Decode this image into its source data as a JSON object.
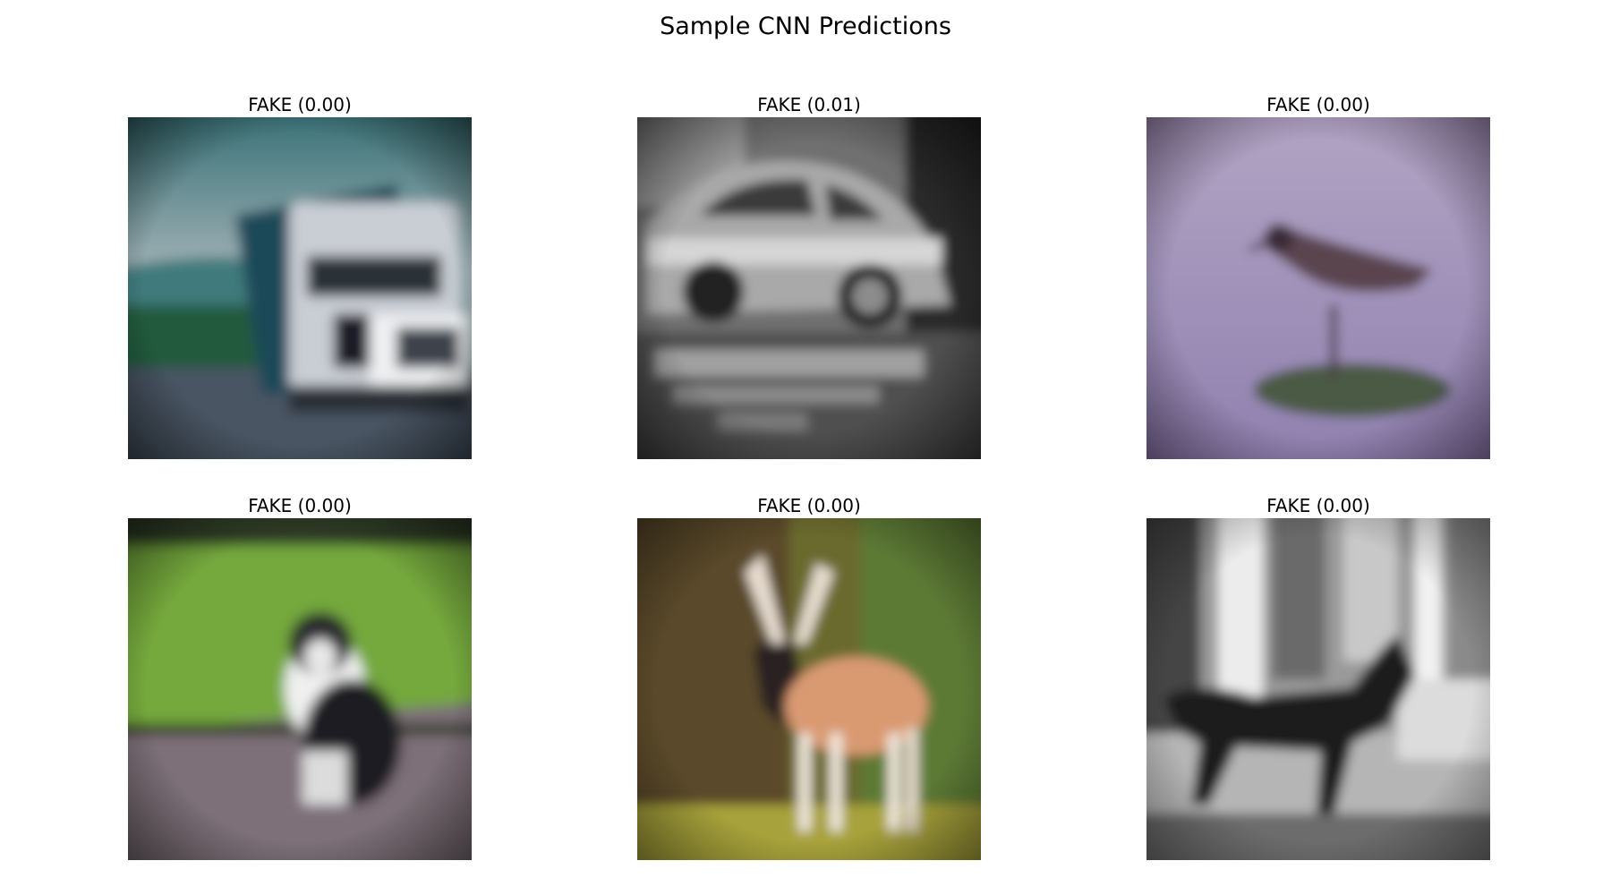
{
  "figure": {
    "title": "Sample CNN Predictions"
  },
  "panels": [
    {
      "label": "FAKE (0.00)",
      "subject": "truck"
    },
    {
      "label": "FAKE (0.01)",
      "subject": "car"
    },
    {
      "label": "FAKE (0.00)",
      "subject": "bird"
    },
    {
      "label": "FAKE (0.00)",
      "subject": "dog"
    },
    {
      "label": "FAKE (0.00)",
      "subject": "deer"
    },
    {
      "label": "FAKE (0.00)",
      "subject": "dog"
    }
  ]
}
